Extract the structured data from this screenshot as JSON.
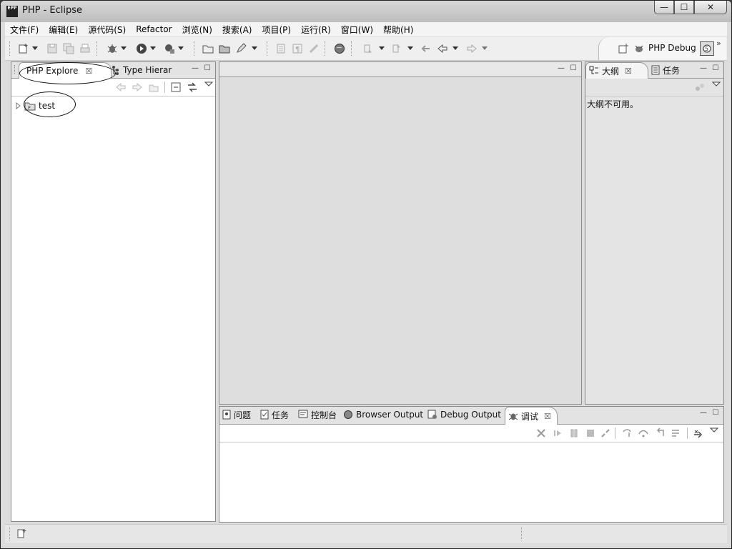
{
  "window": {
    "title": "PHP  -  Eclipse",
    "app_icon": "EPP",
    "buttons": [
      "minimize",
      "maximize",
      "close"
    ]
  },
  "menu": [
    "文件(F)",
    "编辑(E)",
    "源代码(S)",
    "Refactor",
    "浏览(N)",
    "搜索(A)",
    "项目(P)",
    "运行(R)",
    "窗口(W)",
    "帮助(H)"
  ],
  "perspective": {
    "label": "PHP Debug"
  },
  "left_panel": {
    "tabs": [
      {
        "label": "PHP Explore",
        "close": "☒"
      },
      {
        "label": "Type Hierar"
      }
    ],
    "tree": [
      {
        "label": "test"
      }
    ]
  },
  "right_panel": {
    "tabs": [
      {
        "label": "大纲",
        "close": "☒"
      },
      {
        "label": "任务"
      }
    ],
    "message": "大纲不可用。"
  },
  "bottom_panel": {
    "tabs": [
      {
        "label": "问题"
      },
      {
        "label": "任务"
      },
      {
        "label": "控制台"
      },
      {
        "label": "Browser Output"
      },
      {
        "label": "Debug Output"
      },
      {
        "label": "调试",
        "close": "☒"
      }
    ]
  },
  "icons": {
    "minimize": "—",
    "maximize": "☐",
    "close": "✕"
  }
}
